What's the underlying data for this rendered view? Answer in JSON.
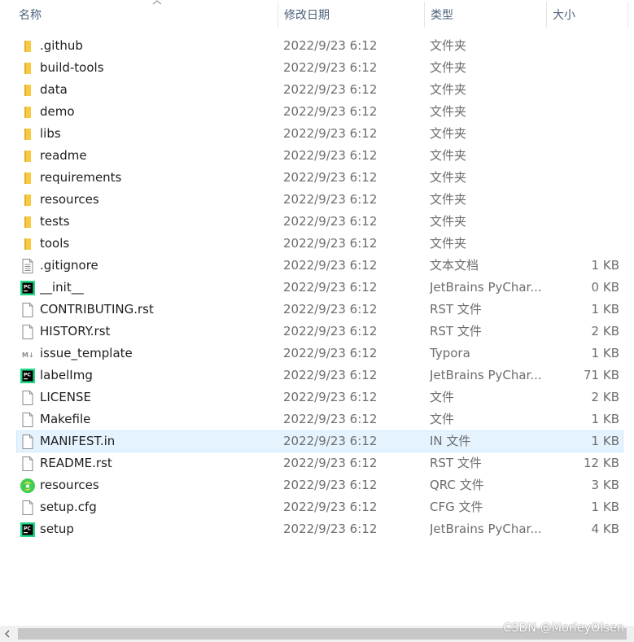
{
  "header": {
    "columns": [
      {
        "label": "名称"
      },
      {
        "label": "修改日期"
      },
      {
        "label": "类型"
      },
      {
        "label": "大小"
      }
    ]
  },
  "files": [
    {
      "name": ".github",
      "date": "2022/9/23 6:12",
      "type": "文件夹",
      "size": "",
      "icon": "folder-icon"
    },
    {
      "name": "build-tools",
      "date": "2022/9/23 6:12",
      "type": "文件夹",
      "size": "",
      "icon": "folder-icon"
    },
    {
      "name": "data",
      "date": "2022/9/23 6:12",
      "type": "文件夹",
      "size": "",
      "icon": "folder-icon"
    },
    {
      "name": "demo",
      "date": "2022/9/23 6:12",
      "type": "文件夹",
      "size": "",
      "icon": "folder-icon"
    },
    {
      "name": "libs",
      "date": "2022/9/23 6:12",
      "type": "文件夹",
      "size": "",
      "icon": "folder-icon"
    },
    {
      "name": "readme",
      "date": "2022/9/23 6:12",
      "type": "文件夹",
      "size": "",
      "icon": "folder-icon"
    },
    {
      "name": "requirements",
      "date": "2022/9/23 6:12",
      "type": "文件夹",
      "size": "",
      "icon": "folder-icon"
    },
    {
      "name": "resources",
      "date": "2022/9/23 6:12",
      "type": "文件夹",
      "size": "",
      "icon": "folder-icon"
    },
    {
      "name": "tests",
      "date": "2022/9/23 6:12",
      "type": "文件夹",
      "size": "",
      "icon": "folder-icon"
    },
    {
      "name": "tools",
      "date": "2022/9/23 6:12",
      "type": "文件夹",
      "size": "",
      "icon": "folder-icon"
    },
    {
      "name": ".gitignore",
      "date": "2022/9/23 6:12",
      "type": "文本文档",
      "size": "1 KB",
      "icon": "text-document-icon"
    },
    {
      "name": "__init__",
      "date": "2022/9/23 6:12",
      "type": "JetBrains PyChar...",
      "size": "0 KB",
      "icon": "pycharm-icon"
    },
    {
      "name": "CONTRIBUTING.rst",
      "date": "2022/9/23 6:12",
      "type": "RST 文件",
      "size": "1 KB",
      "icon": "blank-file-icon"
    },
    {
      "name": "HISTORY.rst",
      "date": "2022/9/23 6:12",
      "type": "RST 文件",
      "size": "2 KB",
      "icon": "blank-file-icon"
    },
    {
      "name": "issue_template",
      "date": "2022/9/23 6:12",
      "type": "Typora",
      "size": "1 KB",
      "icon": "markdown-icon"
    },
    {
      "name": "labelImg",
      "date": "2022/9/23 6:12",
      "type": "JetBrains PyChar...",
      "size": "71 KB",
      "icon": "pycharm-icon"
    },
    {
      "name": "LICENSE",
      "date": "2022/9/23 6:12",
      "type": "文件",
      "size": "2 KB",
      "icon": "blank-file-icon"
    },
    {
      "name": "Makefile",
      "date": "2022/9/23 6:12",
      "type": "文件",
      "size": "1 KB",
      "icon": "blank-file-icon"
    },
    {
      "name": "MANIFEST.in",
      "date": "2022/9/23 6:12",
      "type": "IN 文件",
      "size": "1 KB",
      "icon": "blank-file-icon",
      "selected": true
    },
    {
      "name": "README.rst",
      "date": "2022/9/23 6:12",
      "type": "RST 文件",
      "size": "12 KB",
      "icon": "blank-file-icon"
    },
    {
      "name": "resources",
      "date": "2022/9/23 6:12",
      "type": "QRC 文件",
      "size": "3 KB",
      "icon": "qrc-icon"
    },
    {
      "name": "setup.cfg",
      "date": "2022/9/23 6:12",
      "type": "CFG 文件",
      "size": "1 KB",
      "icon": "blank-file-icon"
    },
    {
      "name": "setup",
      "date": "2022/9/23 6:12",
      "type": "JetBrains PyChar...",
      "size": "4 KB",
      "icon": "pycharm-icon"
    }
  ],
  "watermark": "CSDN @MorleyOlsen",
  "colors": {
    "folder": "#f8c943",
    "selection": "#e5f3ff",
    "header_text": "#4c607a",
    "pycharm_green": "#21d789"
  }
}
